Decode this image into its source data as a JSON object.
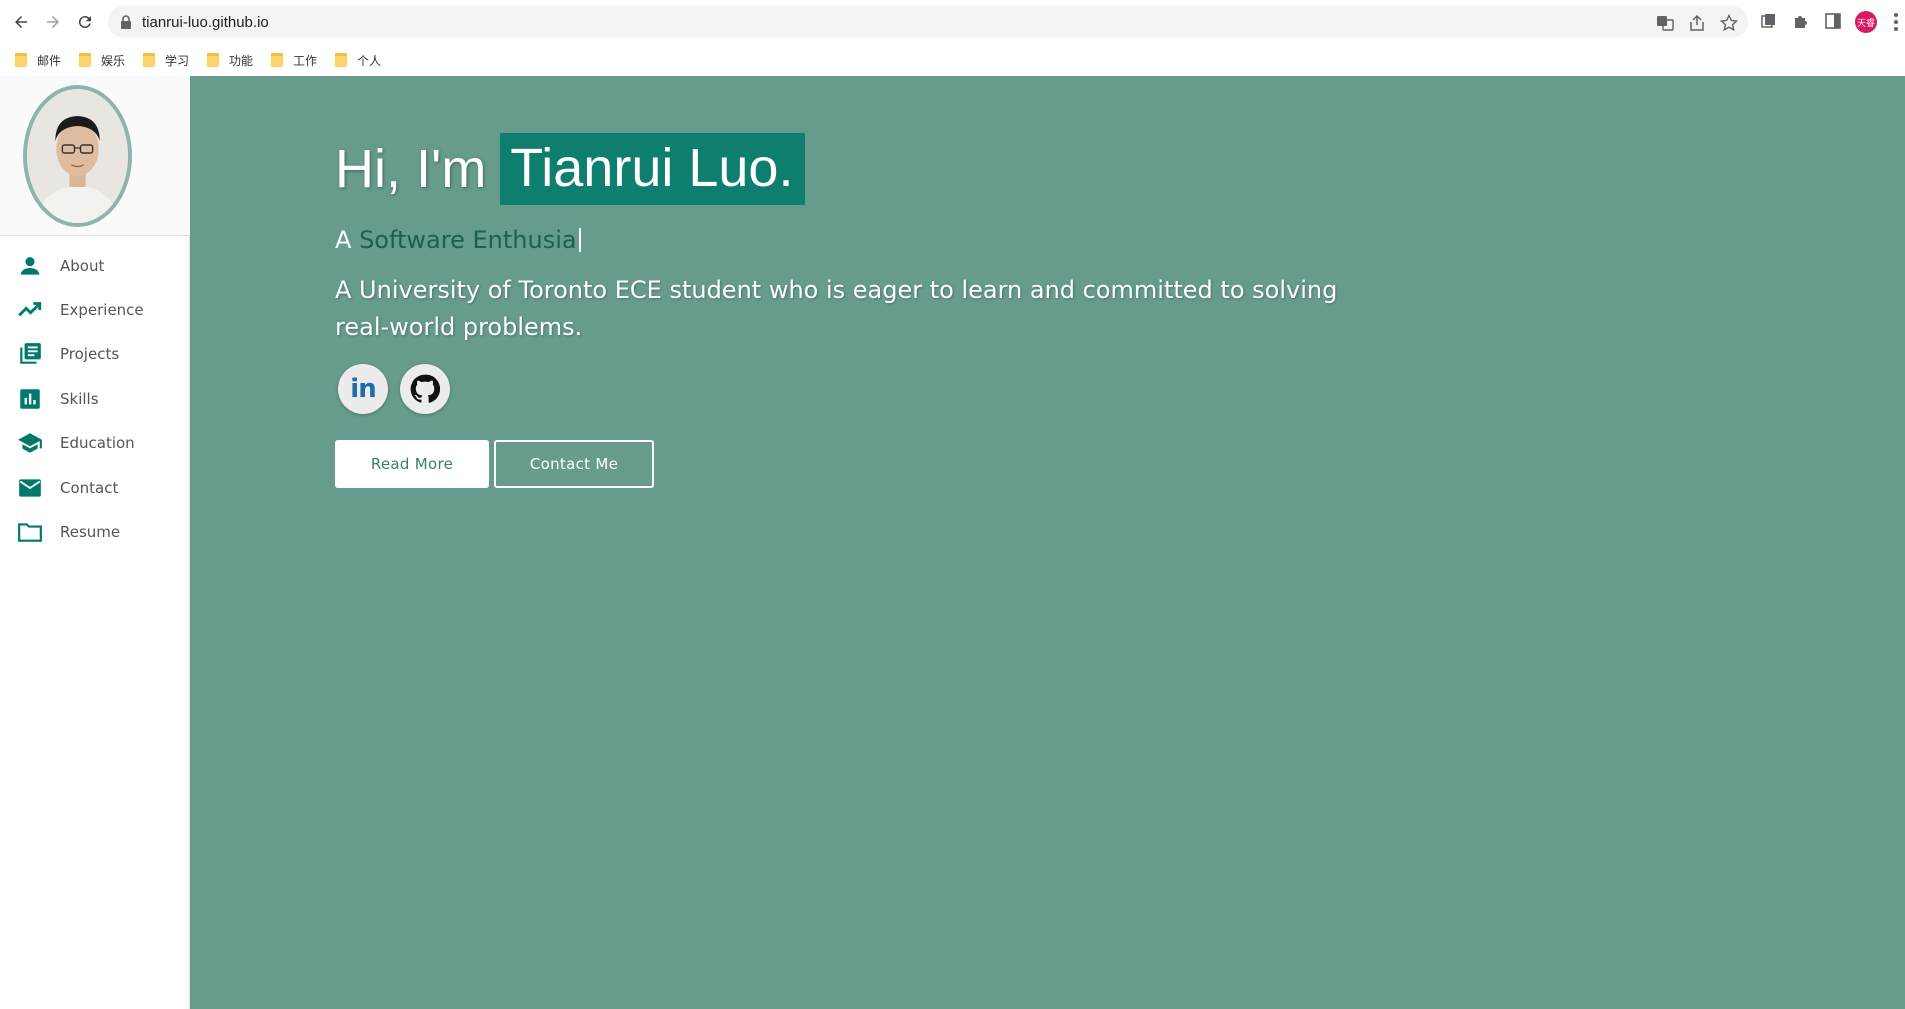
{
  "browser": {
    "url": "tianrui-luo.github.io",
    "profile_initials": "天睿",
    "bookmarks": [
      "邮件",
      "娱乐",
      "学习",
      "功能",
      "工作",
      "个人"
    ]
  },
  "sidebar": {
    "items": [
      {
        "label": "About",
        "icon": "person-icon"
      },
      {
        "label": "Experience",
        "icon": "trending-up-icon"
      },
      {
        "label": "Projects",
        "icon": "library-books-icon"
      },
      {
        "label": "Skills",
        "icon": "bar-chart-icon"
      },
      {
        "label": "Education",
        "icon": "school-icon"
      },
      {
        "label": "Contact",
        "icon": "mail-icon"
      },
      {
        "label": "Resume",
        "icon": "folder-icon"
      }
    ]
  },
  "hero": {
    "greeting_prefix": "Hi, I'm",
    "name": "Tianrui Luo.",
    "subtitle_prefix": "A",
    "subtitle_typed": "Software Enthusia",
    "description": "A University of Toronto ECE student who is eager to learn and committed to solving real-world problems.",
    "social": [
      "linkedin-icon",
      "github-icon"
    ],
    "linkedin_glyph": "in",
    "read_more_label": "Read More",
    "contact_label": "Contact Me"
  },
  "colors": {
    "hero_bg": "#669b8e",
    "name_highlight": "#0e7e6e",
    "accent": "#00796b"
  }
}
